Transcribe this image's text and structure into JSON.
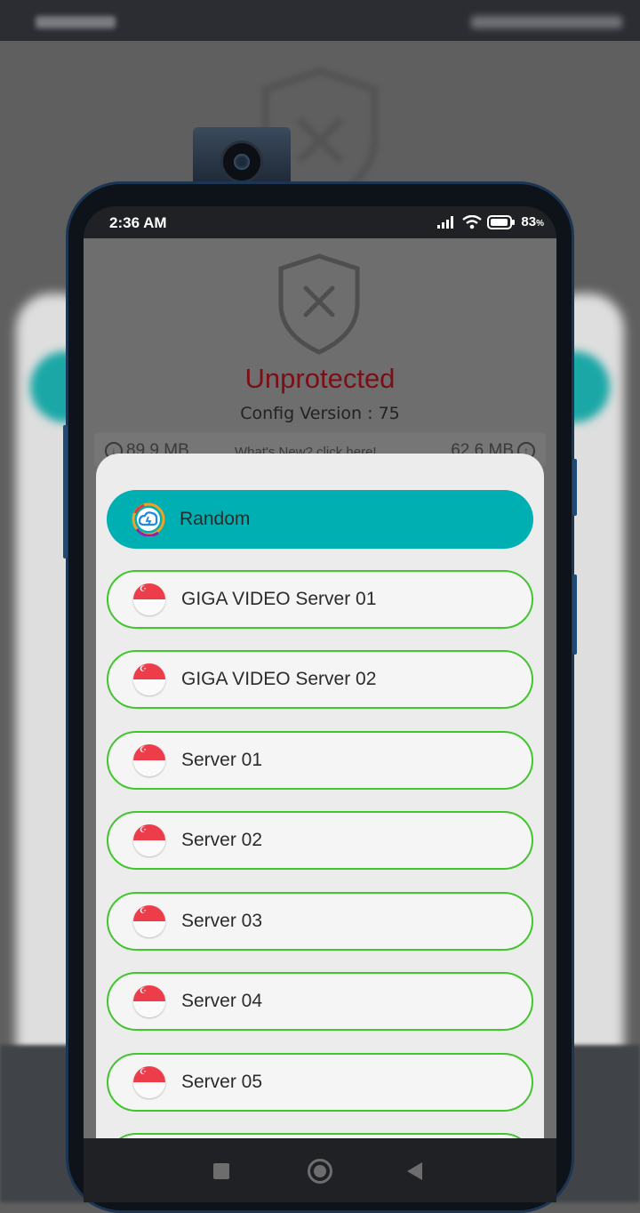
{
  "status_bar": {
    "time": "2:36 AM",
    "battery": "83"
  },
  "app": {
    "status_title": "Unprotected",
    "config_version": "Config Version : 75",
    "download": "89.9 MB",
    "whats_new": "What's New? click here!",
    "upload": "62.6 MB"
  },
  "servers": {
    "random": "Random",
    "items": [
      "GIGA VIDEO Server 01",
      "GIGA VIDEO Server 02",
      "Server 01",
      "Server 02",
      "Server 03",
      "Server 04",
      "Server 05"
    ]
  },
  "colors": {
    "accent_teal": "#00afb1",
    "border_green": "#42c52f",
    "status_red": "#7c0e16",
    "flag_red": "#ee3d4a"
  },
  "icons": {
    "random": "random-cloud-icon",
    "flag": "singapore-flag-icon",
    "shield": "shield-x-icon"
  }
}
